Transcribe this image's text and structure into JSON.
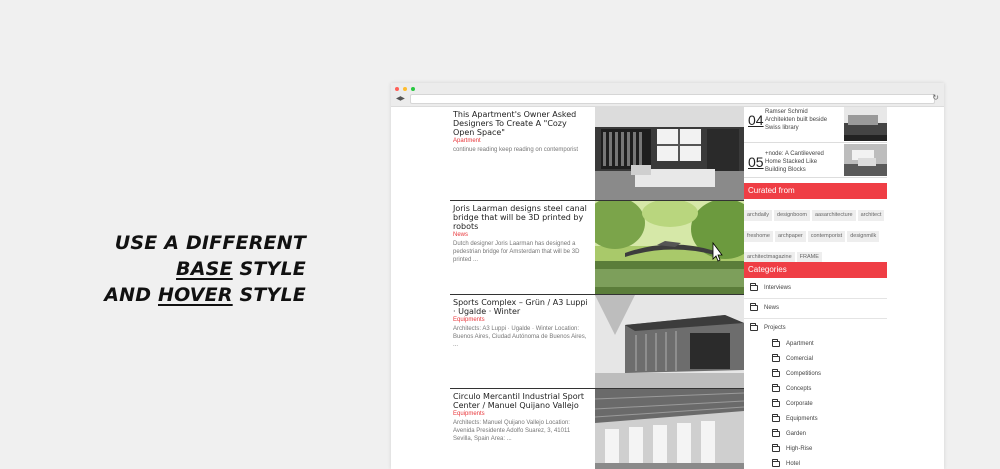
{
  "headline": {
    "line1": "USE A DIFFERENT",
    "base": "BASE",
    "line2_rest": " STYLE",
    "line3_pre": "AND ",
    "hover": "HOVER",
    "line3_rest": " STYLE"
  },
  "colors": {
    "accent": "#ef3e45",
    "category": "#e8363a"
  },
  "browser": {
    "nav": "◀ ▶",
    "reload": "↻"
  },
  "posts": [
    {
      "title": "This Apartment's Owner Asked Designers To Create A \"Cozy Open Space\"",
      "category": "Apartment",
      "excerpt": "continue reading keep reading on contemporist"
    },
    {
      "title": "Joris Laarman designs steel canal bridge that will be 3D printed by robots",
      "category": "News",
      "excerpt": "Dutch designer Joris Laarman has designed a pedestrian bridge for Amsterdam that will be 3D printed ..."
    },
    {
      "title": "Sports Complex – Grün / A3 Luppi · Ugalde · Winter",
      "category": "Equipments",
      "excerpt": "Architects: A3 Luppi · Ugalde · Winter Location: Buenos Aires, Ciudad Autónoma de Buenos Aires, ..."
    },
    {
      "title": "Circulo Mercantil Industrial Sport Center / Manuel Quijano Vallejo",
      "category": "Equipments",
      "excerpt": "Architects: Manuel Quijano Vallejo Location: Avenida Presidente Adolfo Suarez, 3, 41011 Sevilla, Spain Area: ..."
    }
  ],
  "numbered": [
    {
      "num": "04",
      "text": "Ramser Schmid Architekten built beside Swiss library"
    },
    {
      "num": "05",
      "text": "+node: A Cantilevered Home Stacked Like Building Blocks"
    }
  ],
  "curated": {
    "title": "Curated from",
    "tags": [
      "archdaily",
      "designboom",
      "aasarchitecture",
      "architect",
      "freshome",
      "archpaper",
      "contemporist",
      "designmilk",
      "architectmagazine",
      "FRAME"
    ]
  },
  "categories": {
    "title": "Categories",
    "top": [
      "Interviews",
      "News",
      "Projects"
    ],
    "projects": [
      "Apartment",
      "Comercial",
      "Competitions",
      "Concepts",
      "Corporate",
      "Equipments",
      "Garden",
      "High-Rise",
      "Hotel"
    ]
  }
}
